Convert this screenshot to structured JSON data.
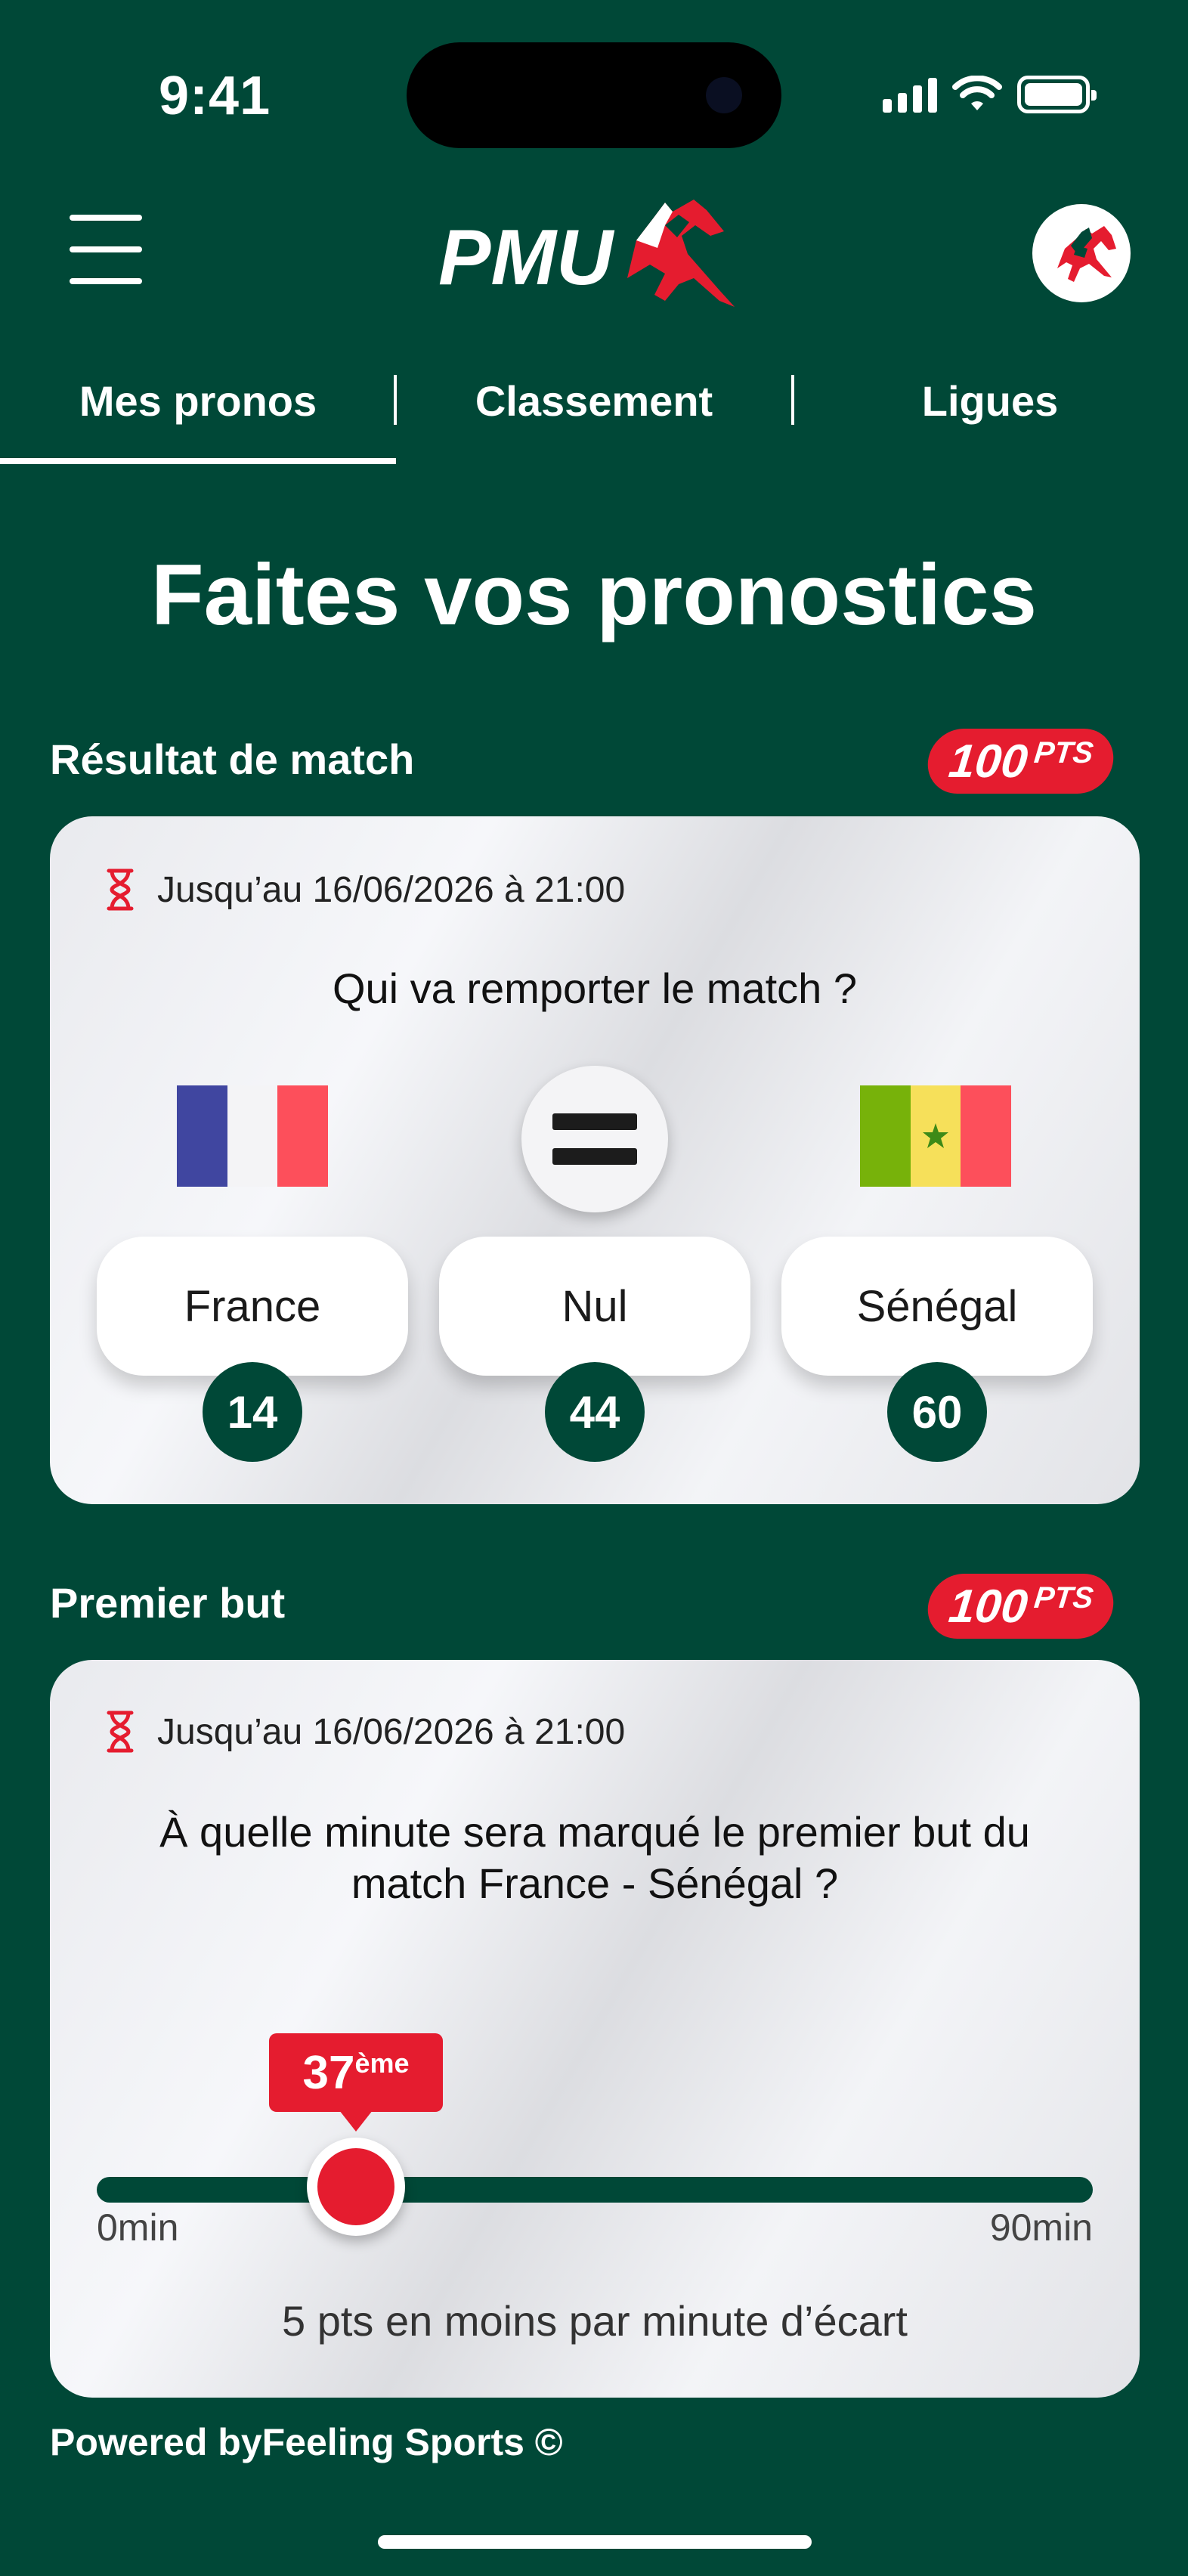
{
  "status_bar": {
    "time": "9:41",
    "icons": [
      "cellular-signal-icon",
      "wifi-icon",
      "battery-icon"
    ]
  },
  "header": {
    "logo_text": "PMU",
    "menu_icon": "hamburger-icon",
    "avatar_icon": "horse-rider-icon"
  },
  "tabs": [
    {
      "label": "Mes pronos",
      "active": true
    },
    {
      "label": "Classement",
      "active": false
    },
    {
      "label": "Ligues",
      "active": false
    }
  ],
  "page_title": "Faites vos pronostics",
  "match_result": {
    "section_label": "Résultat de match",
    "points": "100",
    "points_unit": "PTS",
    "deadline": "Jusqu’au 16/06/2026 à 21:00",
    "question": "Qui va remporter le match ?",
    "options": [
      {
        "label": "France",
        "count": "14",
        "icon": "france-flag-icon"
      },
      {
        "label": "Nul",
        "count": "44",
        "icon": "equals-icon"
      },
      {
        "label": "Sénégal",
        "count": "60",
        "icon": "senegal-flag-icon"
      }
    ]
  },
  "first_goal": {
    "section_label": "Premier but",
    "points": "100",
    "points_unit": "PTS",
    "deadline": "Jusqu’au 16/06/2026 à 21:00",
    "question_line1": "À quelle minute sera marqué le premier but du",
    "question_line2": "match France - Sénégal ?",
    "slider_value": "37",
    "slider_suffix": "ème",
    "slider_min_label": "0min",
    "slider_max_label": "90min",
    "slider_min": 0,
    "slider_max": 90,
    "note": "5 pts en moins par minute d’écart"
  },
  "footer": {
    "powered": "Powered byFeeling Sports ©"
  },
  "colors": {
    "background": "#004837",
    "accent_red": "#e51c2f",
    "card": "#eeeff2",
    "france_blue": "#4046a0",
    "france_red": "#fd4f5b",
    "senegal_green": "#77b20a",
    "senegal_yellow": "#f6e05a"
  }
}
